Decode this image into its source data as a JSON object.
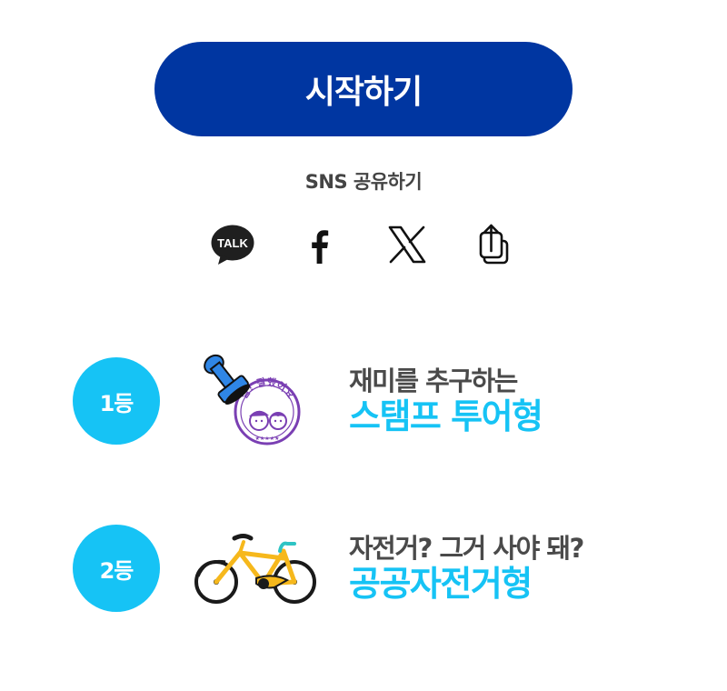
{
  "start_button": {
    "label": "시작하기"
  },
  "share": {
    "label": "SNS 공유하기",
    "items": [
      {
        "name": "kakaotalk",
        "icon": "kakaotalk-icon",
        "text": "TALK"
      },
      {
        "name": "facebook",
        "icon": "facebook-icon"
      },
      {
        "name": "x",
        "icon": "x-icon"
      },
      {
        "name": "share",
        "icon": "share-icon"
      }
    ]
  },
  "ranking": [
    {
      "rank": "1등",
      "image": "stamp-icon",
      "stamp_text": "참! 잘했어요",
      "subtitle": "재미를 추구하는",
      "title": "스탬프 투어형"
    },
    {
      "rank": "2등",
      "image": "bicycle-icon",
      "subtitle": "자전거? 그거 사야 돼?",
      "title": "공공자전거형"
    }
  ],
  "colors": {
    "primary": "#0036a1",
    "accent": "#16c3f5",
    "text_dark": "#4a4a4a",
    "stamp_purple": "#7a3fb3",
    "bike_yellow": "#f6b81c"
  }
}
